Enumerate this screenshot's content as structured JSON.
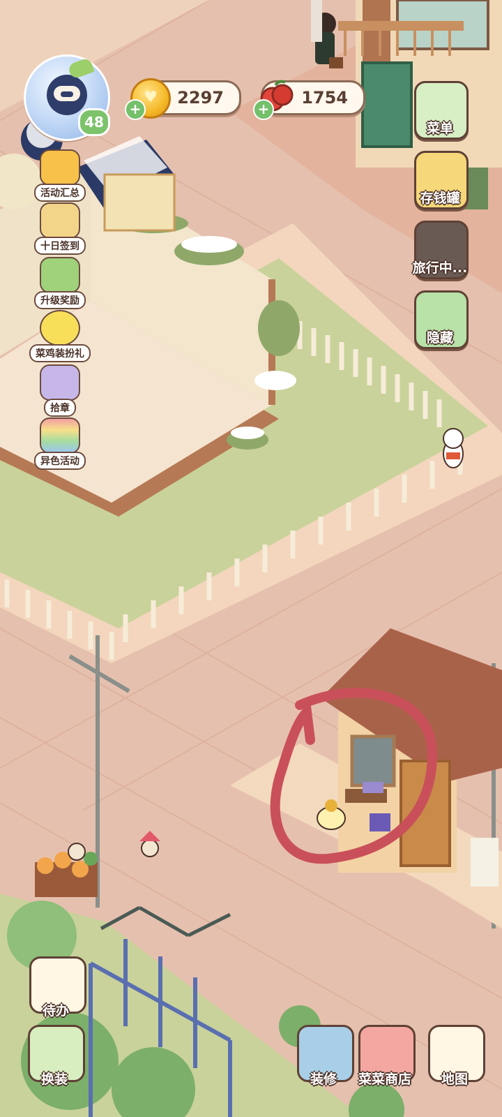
{
  "player": {
    "level": "48"
  },
  "resources": {
    "coins": "2297",
    "tomatoes": "1754"
  },
  "left_menu": [
    {
      "label": "活动汇总",
      "icon": "house-event-icon"
    },
    {
      "label": "十日签到",
      "icon": "checkin-basket-icon"
    },
    {
      "label": "升级奖励",
      "icon": "level-up-arrow-icon"
    },
    {
      "label": "菜鸡装扮礼",
      "icon": "duck-icon"
    },
    {
      "label": "拾章",
      "icon": "stamp-icon"
    },
    {
      "label": "异色活动",
      "icon": "rainbow-icon"
    }
  ],
  "right_menu": [
    {
      "label": "菜单",
      "icon": "menu-icon"
    },
    {
      "label": "存钱罐",
      "icon": "piggy-bank-icon"
    },
    {
      "label": "旅行中...",
      "icon": "camera-icon"
    },
    {
      "label": "隐藏",
      "icon": "hide-frame-icon"
    }
  ],
  "bottom_left": [
    {
      "label": "待办",
      "icon": "todo-clipboard-icon"
    },
    {
      "label": "换装",
      "icon": "outfit-icon"
    }
  ],
  "bottom_right": [
    {
      "label": "装修",
      "icon": "decorate-icon"
    },
    {
      "label": "菜菜商店",
      "icon": "shop-icon"
    },
    {
      "label": "地图",
      "icon": "map-icon"
    }
  ],
  "colors": {
    "ground": "#e8c4b4",
    "grass": "#c9d29a",
    "annotation_circle": "#c9505a"
  }
}
